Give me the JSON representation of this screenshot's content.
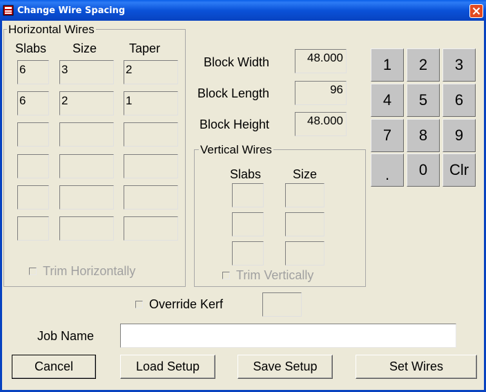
{
  "window": {
    "title": "Change Wire Spacing"
  },
  "horizontal": {
    "title": "Horizontal Wires",
    "col_slabs": "Slabs",
    "col_size": "Size",
    "col_taper": "Taper",
    "rows": [
      {
        "slabs": "6",
        "size": "3",
        "taper": "2"
      },
      {
        "slabs": "6",
        "size": "2",
        "taper": "1"
      },
      {
        "slabs": "",
        "size": "",
        "taper": ""
      },
      {
        "slabs": "",
        "size": "",
        "taper": ""
      },
      {
        "slabs": "",
        "size": "",
        "taper": ""
      },
      {
        "slabs": "",
        "size": "",
        "taper": ""
      }
    ],
    "trim_label": "Trim Horizontally"
  },
  "block": {
    "width_label": "Block Width",
    "width_value": "48.000",
    "length_label": "Block Length",
    "length_value": "96",
    "height_label": "Block Height",
    "height_value": "48.000"
  },
  "vertical": {
    "title": "Vertical Wires",
    "col_slabs": "Slabs",
    "col_size": "Size",
    "rows": [
      {
        "slabs": "",
        "size": ""
      },
      {
        "slabs": "",
        "size": ""
      },
      {
        "slabs": "",
        "size": ""
      }
    ],
    "trim_label": "Trim Vertically"
  },
  "keypad": {
    "keys": [
      "1",
      "2",
      "3",
      "4",
      "5",
      "6",
      "7",
      "8",
      "9",
      ".",
      "0",
      "Clr"
    ]
  },
  "override": {
    "label": "Override Kerf",
    "value": ""
  },
  "job": {
    "label": "Job Name",
    "value": ""
  },
  "buttons": {
    "cancel": "Cancel",
    "load": "Load Setup",
    "save": "Save Setup",
    "set": "Set Wires"
  }
}
